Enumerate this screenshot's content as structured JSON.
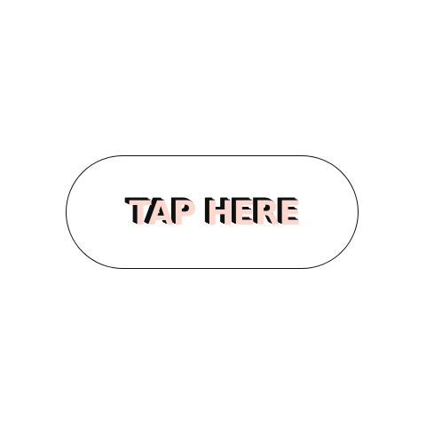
{
  "button": {
    "label": "TAP HERE"
  },
  "colors": {
    "background": "#ffffff",
    "outline": "#111111",
    "label_fill": "#fbd8d0",
    "label_shadow": "#111111"
  }
}
